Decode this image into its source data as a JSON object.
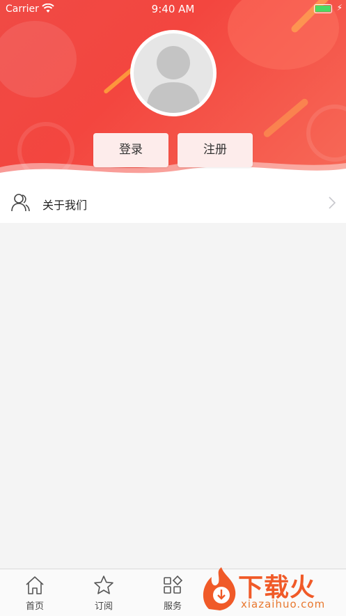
{
  "status_bar": {
    "carrier": "Carrier",
    "time": "9:40 AM"
  },
  "actions": {
    "login_label": "登录",
    "register_label": "注册"
  },
  "menu": {
    "about_label": "关于我们"
  },
  "tabs": [
    {
      "label": "首页",
      "icon": "home-icon"
    },
    {
      "label": "订阅",
      "icon": "star-icon"
    },
    {
      "label": "服务",
      "icon": "grid-icon"
    }
  ],
  "watermark": {
    "text": "下载火",
    "domain": "xiazaihuo.com"
  },
  "colors": {
    "header": "#f04a45",
    "button_bg": "#fdeceb",
    "watermark": "#f05a28"
  }
}
